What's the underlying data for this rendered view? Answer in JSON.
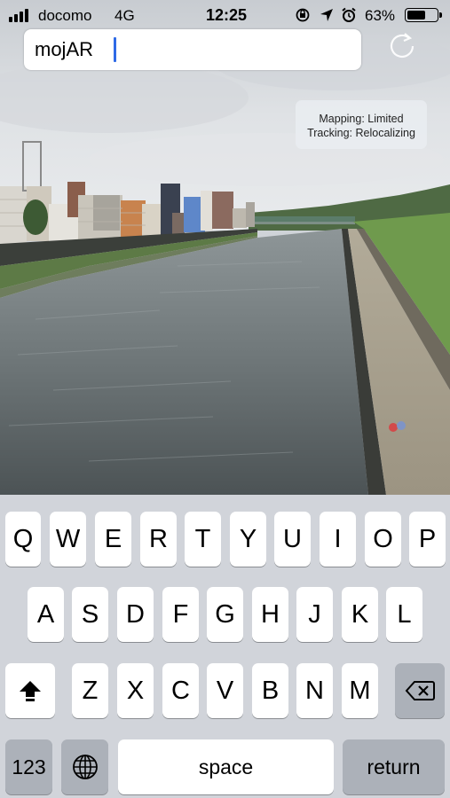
{
  "status_bar": {
    "carrier": "docomo",
    "network": "4G",
    "time": "12:25",
    "battery_percent": "63%",
    "battery_level": 0.63,
    "icons": [
      "signal-icon",
      "orientation-lock-icon",
      "location-arrow-icon",
      "alarm-icon",
      "battery-icon"
    ]
  },
  "search": {
    "value": "mojAR"
  },
  "reset_button": {
    "icon": "refresh-icon"
  },
  "ar_status": {
    "mapping": "Mapping: Limited",
    "tracking": "Tracking: Relocalizing"
  },
  "keyboard": {
    "row1": [
      "Q",
      "W",
      "E",
      "R",
      "T",
      "Y",
      "U",
      "I",
      "O",
      "P"
    ],
    "row2": [
      "A",
      "S",
      "D",
      "F",
      "G",
      "H",
      "J",
      "K",
      "L"
    ],
    "row3": [
      "Z",
      "X",
      "C",
      "V",
      "B",
      "N",
      "M"
    ],
    "numbers_label": "123",
    "space_label": "space",
    "return_label": "return",
    "shift_icon": "shift-icon",
    "delete_icon": "delete-icon",
    "globe_icon": "globe-icon"
  },
  "colors": {
    "cursor": "#2f6ae6",
    "key": "#ffffff",
    "key_dark": "#acb1b9",
    "keyboard_bg": "#d1d4da"
  }
}
